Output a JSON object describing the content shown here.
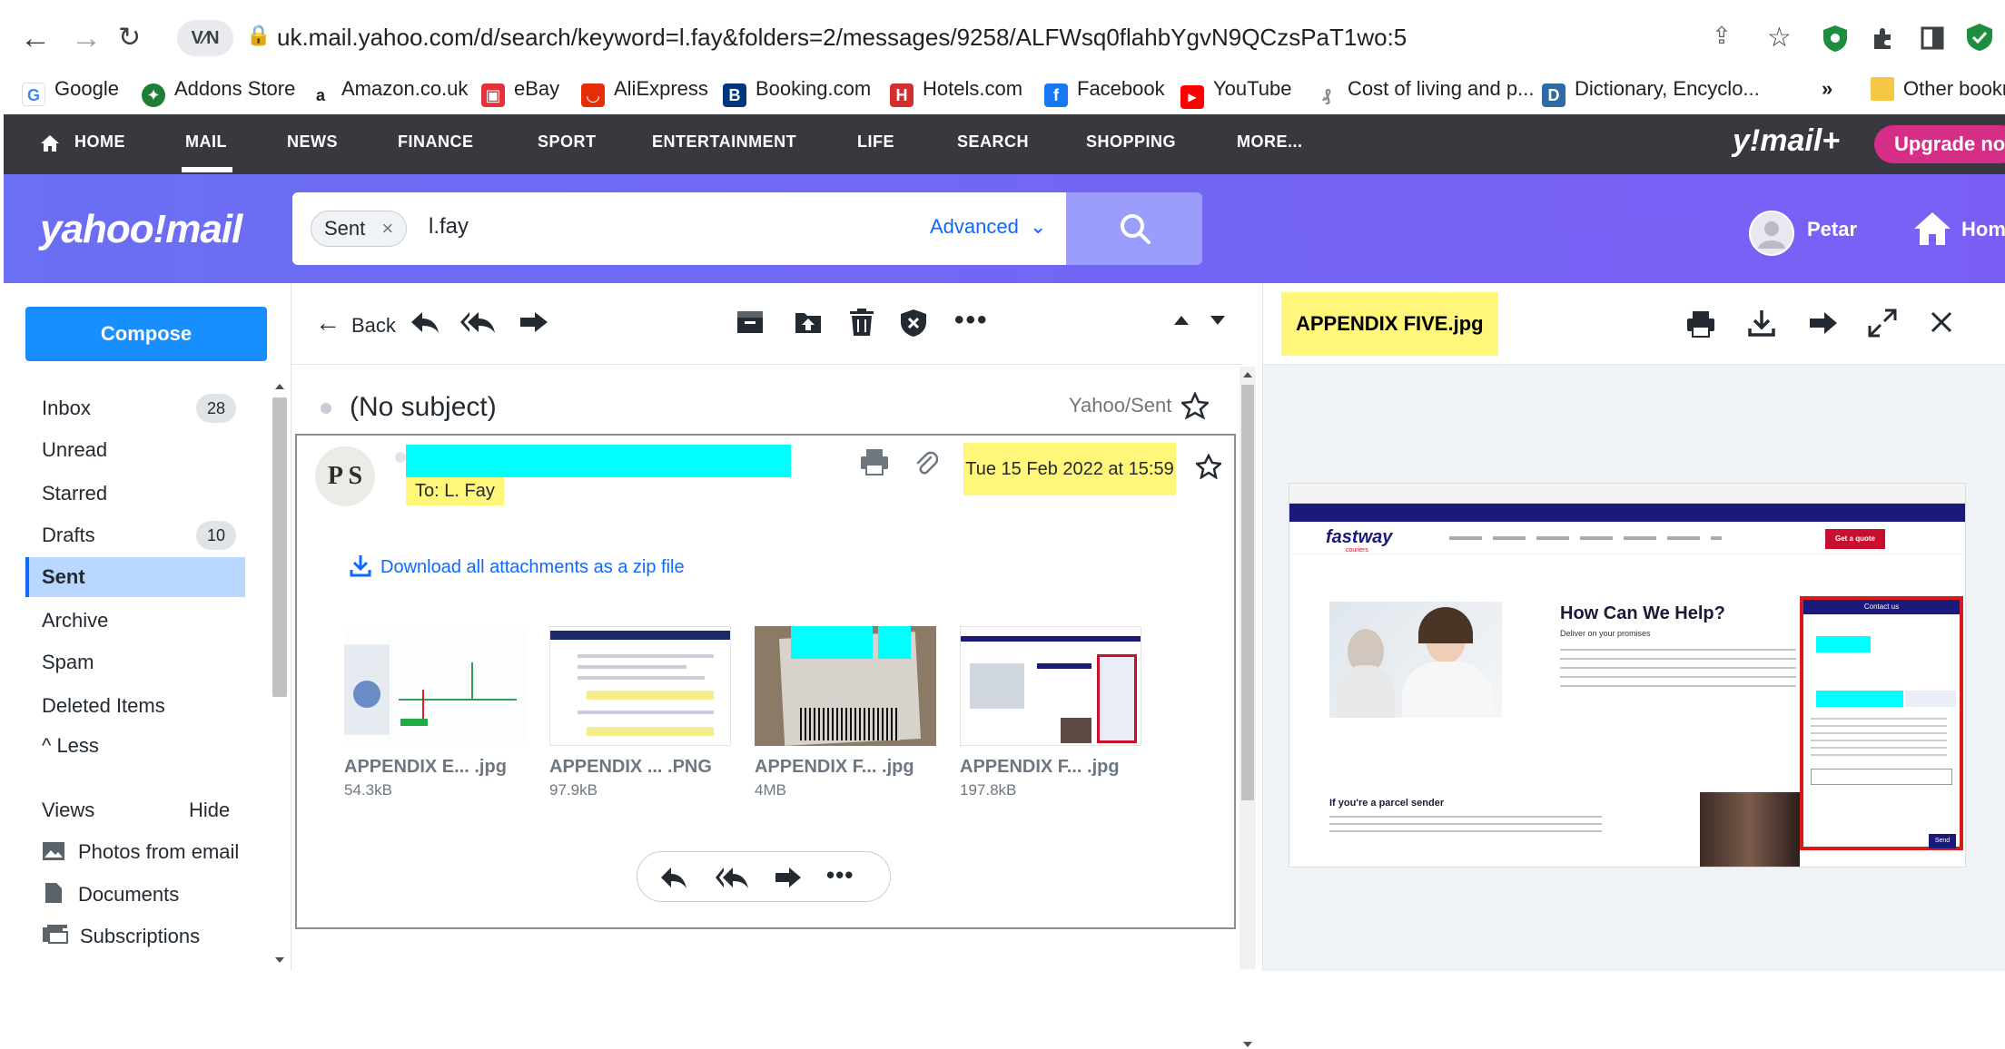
{
  "browser": {
    "url": "uk.mail.yahoo.com/d/search/keyword=l.fay&folders=2/messages/9258/ALFWsq0flahbYgvN9QCzsPaT1wo:5",
    "bookmarks": [
      {
        "label": "Google",
        "icon": "google-icon",
        "color": "#4285f4"
      },
      {
        "label": "Addons Store",
        "icon": "addons-icon",
        "color": "#1e7e34"
      },
      {
        "label": "Amazon.co.uk",
        "icon": "amazon-icon",
        "color": "#222222"
      },
      {
        "label": "eBay",
        "icon": "ebay-icon",
        "color": "#e53238"
      },
      {
        "label": "AliExpress",
        "icon": "aliexpress-icon",
        "color": "#e62e04"
      },
      {
        "label": "Booking.com",
        "icon": "booking-icon",
        "color": "#003580"
      },
      {
        "label": "Hotels.com",
        "icon": "hotels-icon",
        "color": "#d32f2f"
      },
      {
        "label": "Facebook",
        "icon": "facebook-icon",
        "color": "#1877f2"
      },
      {
        "label": "YouTube",
        "icon": "youtube-icon",
        "color": "#ff0000"
      },
      {
        "label": "Cost of living and p...",
        "icon": "cost-icon",
        "color": "#888888"
      },
      {
        "label": "Dictionary, Encyclo...",
        "icon": "dictionary-icon",
        "color": "#2e6da4"
      }
    ],
    "more_bookmarks": "»",
    "other_bookmarks": "Other bookm"
  },
  "ynav": {
    "items": [
      "HOME",
      "MAIL",
      "NEWS",
      "FINANCE",
      "SPORT",
      "ENTERTAINMENT",
      "LIFE",
      "SEARCH",
      "SHOPPING",
      "MORE..."
    ],
    "brand": "y!mail+",
    "upgrade": "Upgrade now"
  },
  "header": {
    "logo": "yahoo!mail",
    "search_chip": "Sent",
    "search_value": "l.fay",
    "advanced": "Advanced",
    "user_name": "Petar",
    "home": "Hom"
  },
  "sidebar": {
    "compose": "Compose",
    "folders": [
      {
        "label": "Inbox",
        "count": "28"
      },
      {
        "label": "Unread",
        "count": ""
      },
      {
        "label": "Starred",
        "count": ""
      },
      {
        "label": "Drafts",
        "count": "10"
      },
      {
        "label": "Sent",
        "count": ""
      },
      {
        "label": "Archive",
        "count": ""
      },
      {
        "label": "Spam",
        "count": ""
      },
      {
        "label": "Deleted Items",
        "count": ""
      }
    ],
    "less": "Less",
    "views_label": "Views",
    "hide": "Hide",
    "views": [
      "Photos from email",
      "Documents",
      "Subscriptions"
    ]
  },
  "message": {
    "back": "Back",
    "subject": "(No subject)",
    "folder": "Yahoo/Sent",
    "avatar_initials": "P S",
    "to": "To: L. Fay",
    "date": "Tue 15 Feb 2022 at 15:59",
    "download_all": "Download all attachments as a zip file",
    "attachments": [
      {
        "name": "APPENDIX E... .jpg",
        "size": "54.3kB"
      },
      {
        "name": "APPENDIX ... .PNG",
        "size": "97.9kB"
      },
      {
        "name": "APPENDIX F... .jpg",
        "size": "4MB"
      },
      {
        "name": "APPENDIX F... .jpg",
        "size": "197.8kB"
      }
    ]
  },
  "preview": {
    "title": "APPENDIX FIVE.jpg",
    "image": {
      "brand": "fastway",
      "brand_sub": "couriers",
      "heading": "How Can We Help?",
      "subheading": "Deliver on your promises",
      "contact_title": "Contact us",
      "sender_heading": "If you're a parcel sender",
      "quote_btn": "Get a quote",
      "send_btn": "Send"
    }
  },
  "colors": {
    "nav_bg": "#37393e",
    "header_purple": "#6a6ff3",
    "accent_blue": "#0f69ff",
    "highlight_yellow": "#fff67a",
    "redaction_cyan": "#00ffff",
    "upgrade_pink": "#d62d87"
  }
}
